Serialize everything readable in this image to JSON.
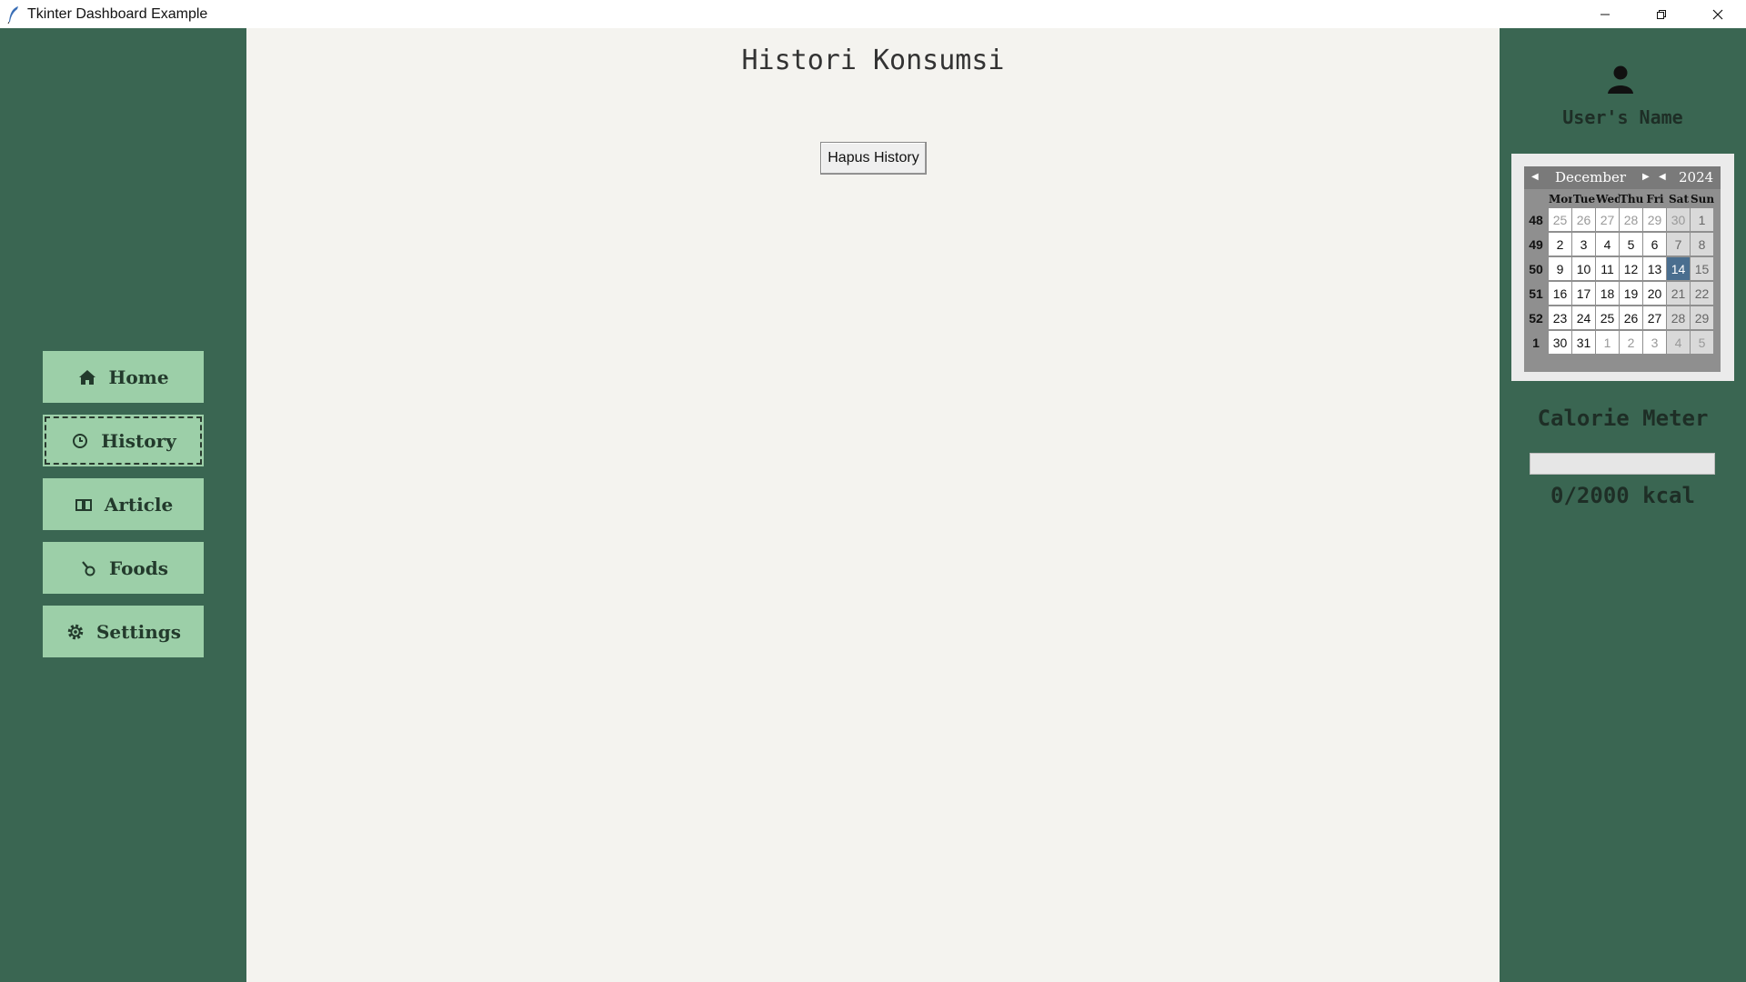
{
  "window": {
    "title": "Tkinter Dashboard Example",
    "controls": [
      "minimize",
      "maximize",
      "close"
    ]
  },
  "sidebar": {
    "items": [
      {
        "label": "Home",
        "icon": "home-icon"
      },
      {
        "label": "History",
        "icon": "clock-icon",
        "focused": true
      },
      {
        "label": "Article",
        "icon": "book-icon"
      },
      {
        "label": "Foods",
        "icon": "food-icon"
      },
      {
        "label": "Settings",
        "icon": "gear-icon"
      }
    ]
  },
  "main": {
    "title": "Histori Konsumsi",
    "clear_button": "Hapus History"
  },
  "user": {
    "name": "User's Name"
  },
  "calendar": {
    "month": "December",
    "year": "2024",
    "weekdays": [
      "Mon",
      "Tue",
      "Wed",
      "Thu",
      "Fri",
      "Sat",
      "Sun"
    ],
    "weeks": [
      {
        "num": "48",
        "days": [
          "25",
          "26",
          "27",
          "28",
          "29",
          "30",
          "1"
        ],
        "other": [
          true,
          true,
          true,
          true,
          true,
          true,
          false
        ]
      },
      {
        "num": "49",
        "days": [
          "2",
          "3",
          "4",
          "5",
          "6",
          "7",
          "8"
        ],
        "other": [
          false,
          false,
          false,
          false,
          false,
          false,
          false
        ]
      },
      {
        "num": "50",
        "days": [
          "9",
          "10",
          "11",
          "12",
          "13",
          "14",
          "15"
        ],
        "other": [
          false,
          false,
          false,
          false,
          false,
          false,
          false
        ]
      },
      {
        "num": "51",
        "days": [
          "16",
          "17",
          "18",
          "19",
          "20",
          "21",
          "22"
        ],
        "other": [
          false,
          false,
          false,
          false,
          false,
          false,
          false
        ]
      },
      {
        "num": "52",
        "days": [
          "23",
          "24",
          "25",
          "26",
          "27",
          "28",
          "29"
        ],
        "other": [
          false,
          false,
          false,
          false,
          false,
          false,
          false
        ]
      },
      {
        "num": "1",
        "days": [
          "30",
          "31",
          "1",
          "2",
          "3",
          "4",
          "5"
        ],
        "other": [
          false,
          false,
          true,
          true,
          true,
          true,
          true
        ]
      }
    ],
    "selected_day": "14",
    "selected_color": "#4a6e8f"
  },
  "calorie": {
    "title": "Calorie Meter",
    "value_text": "0/2000 kcal",
    "progress": 0
  },
  "colors": {
    "sidebar_bg": "#3a6652",
    "nav_button_bg": "#9ccfa8",
    "main_bg": "#f4f3ef"
  }
}
